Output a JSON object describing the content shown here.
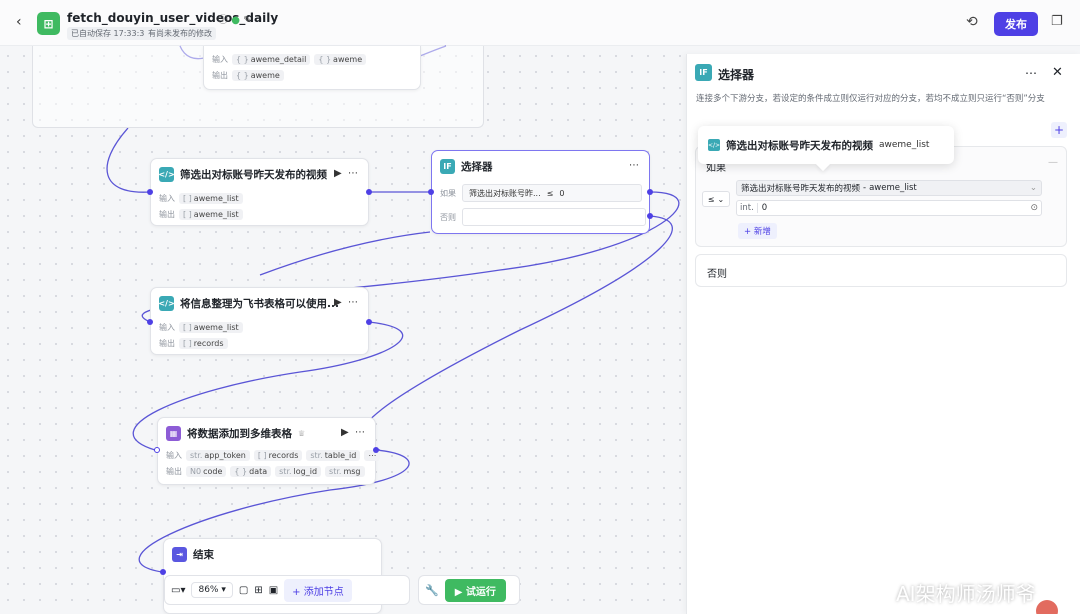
{
  "header": {
    "back_icon": "chevron-left-icon",
    "title": "fetch_douyin_user_videos_daily",
    "autosave": "已自动保存 17:33:37",
    "unpublished": "有尚未发布的修改",
    "publish_label": "发布"
  },
  "nodes": {
    "top_partial": {
      "input_label": "输入",
      "output_label": "输出",
      "input_tags": [
        "aweme_detail",
        "aweme"
      ],
      "output_tags": [
        "aweme"
      ]
    },
    "filter": {
      "title": "筛选出对标账号昨天发布的视频",
      "input_label": "输入",
      "output_label": "输出",
      "input_var": "aweme_list",
      "output_var": "aweme_list"
    },
    "selector": {
      "title": "选择器",
      "if_label": "如果",
      "else_label": "否则",
      "cond_left": "筛选出对标账号昨...",
      "cond_op": "≤",
      "cond_right": "0"
    },
    "organize": {
      "title": "将信息整理为飞书表格可以使用...",
      "input_label": "输入",
      "output_label": "输出",
      "input_var": "aweme_list",
      "output_var": "records"
    },
    "add_table": {
      "title": "将数据添加到多维表格",
      "input_label": "输入",
      "output_label": "输出",
      "inputs": [
        {
          "type": "str.",
          "name": "app_token"
        },
        {
          "type": "[ ]",
          "name": "records"
        },
        {
          "type": "str.",
          "name": "table_id"
        }
      ],
      "outputs": [
        {
          "type": "N0",
          "name": "code"
        },
        {
          "type": "{ }",
          "name": "data"
        },
        {
          "type": "str.",
          "name": "log_id"
        },
        {
          "type": "str.",
          "name": "msg"
        }
      ]
    },
    "end": {
      "title": "结束"
    }
  },
  "toolbar": {
    "zoom": "86%",
    "add_node_label": "添加节点",
    "run_label": "试运行"
  },
  "panel": {
    "title": "选择器",
    "description": "连接多个下游分支，若设定的条件成立则仅运行对应的分支，若均不成立则只运行“否则”分支",
    "if_label": "如果",
    "cond_operator": "≤",
    "cond_left_node": "筛选出对标账号昨天发布的视频",
    "cond_left_sep": "-",
    "cond_left_var": "aweme_list",
    "cond_right_type": "int.",
    "cond_right_value": "0",
    "add_label": "新增",
    "else_label": "否则"
  },
  "tooltip": {
    "title": "筛选出对标账号昨天发布的视频",
    "var": "aweme_list"
  },
  "watermark": "AI架构师汤师爷",
  "colors": {
    "brand": "#4e40e5",
    "run_green": "#3fba61",
    "code_node": "#3aa9b5",
    "table_node": "#8d5cd6",
    "edge": "#5a55d6"
  }
}
